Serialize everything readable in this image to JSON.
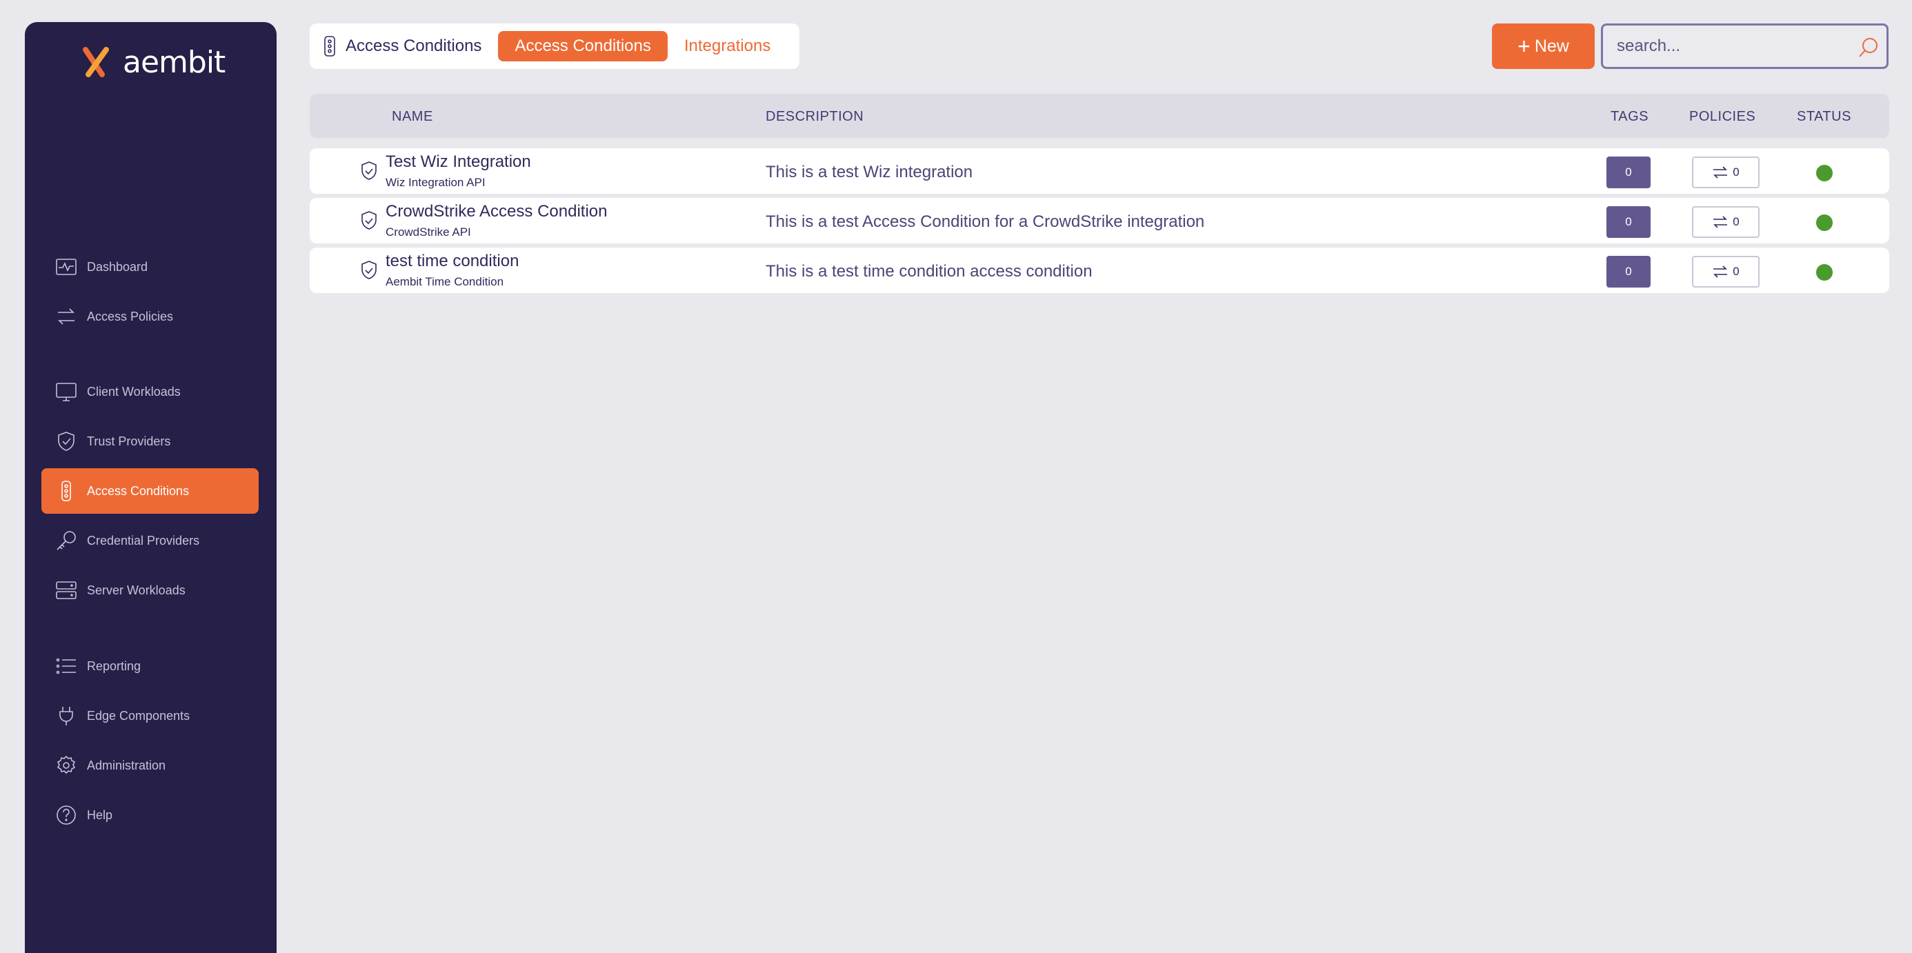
{
  "brand": {
    "name": "aembit",
    "accent": "#ee6a35",
    "sidebar_bg": "#261f47"
  },
  "sidebar": {
    "items": [
      {
        "label": "Dashboard",
        "icon": "pulse-icon",
        "active": false
      },
      {
        "label": "Access Policies",
        "icon": "arrows-swap-icon",
        "active": false
      },
      {
        "label": "Client Workloads",
        "icon": "monitor-icon",
        "active": false
      },
      {
        "label": "Trust Providers",
        "icon": "shield-check-icon",
        "active": false
      },
      {
        "label": "Access Conditions",
        "icon": "traffic-light-icon",
        "active": true
      },
      {
        "label": "Credential Providers",
        "icon": "key-icon",
        "active": false
      },
      {
        "label": "Server Workloads",
        "icon": "server-icon",
        "active": false
      },
      {
        "label": "Reporting",
        "icon": "list-icon",
        "active": false
      },
      {
        "label": "Edge Components",
        "icon": "plug-icon",
        "active": false
      },
      {
        "label": "Administration",
        "icon": "gear-icon",
        "active": false
      },
      {
        "label": "Help",
        "icon": "help-circle-icon",
        "active": false
      }
    ]
  },
  "header": {
    "current_label": "Access Conditions",
    "tabs": [
      {
        "label": "Access Conditions",
        "active": true
      },
      {
        "label": "Integrations",
        "active": false
      }
    ],
    "new_button_label": "New",
    "search_placeholder": "search..."
  },
  "table": {
    "columns": {
      "name": "NAME",
      "description": "DESCRIPTION",
      "tags": "TAGS",
      "policies": "POLICIES",
      "status": "STATUS"
    },
    "rows": [
      {
        "name": "Test Wiz Integration",
        "subtitle": "Wiz Integration API",
        "description": "This is a test Wiz integration",
        "tags": "0",
        "policies": "0",
        "status_color": "#4b9a2e"
      },
      {
        "name": "CrowdStrike Access Condition",
        "subtitle": "CrowdStrike API",
        "description": "This is a test Access Condition for a CrowdStrike integration",
        "tags": "0",
        "policies": "0",
        "status_color": "#4b9a2e"
      },
      {
        "name": "test time condition",
        "subtitle": "Aembit Time Condition",
        "description": "This is a test time condition access condition",
        "tags": "0",
        "policies": "0",
        "status_color": "#4b9a2e"
      }
    ]
  }
}
